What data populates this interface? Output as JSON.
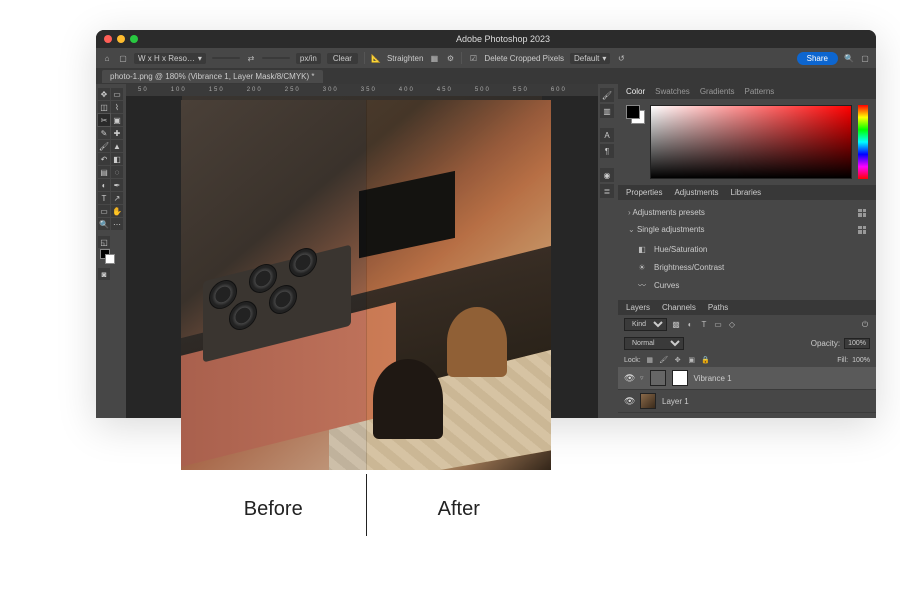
{
  "titlebar": {
    "title": "Adobe Photoshop 2023"
  },
  "optionsbar": {
    "preset": "W x H x Reso…",
    "unit": "px/in",
    "clear": "Clear",
    "straighten": "Straighten",
    "delete_cropped": "Delete Cropped Pixels",
    "content_aware": "Default",
    "share": "Share"
  },
  "doctab": {
    "label": "photo-1.png @ 180% (Vibrance 1, Layer Mask/8/CMYK) *"
  },
  "ruler_ticks": [
    "50",
    "100",
    "150",
    "200",
    "250",
    "300",
    "350",
    "400",
    "450",
    "500",
    "550",
    "600"
  ],
  "color_panel": {
    "tabs": [
      "Color",
      "Swatches",
      "Gradients",
      "Patterns"
    ],
    "active": 0
  },
  "props_panel": {
    "tabs": [
      "Properties",
      "Adjustments",
      "Libraries"
    ],
    "active": 1
  },
  "adjustments": {
    "presets_label": "Adjustments presets",
    "single_label": "Single adjustments",
    "items": [
      {
        "icon": "hue-icon",
        "label": "Hue/Saturation"
      },
      {
        "icon": "brightness-icon",
        "label": "Brightness/Contrast"
      },
      {
        "icon": "curves-icon",
        "label": "Curves"
      }
    ]
  },
  "layers_panel": {
    "tabs": [
      "Layers",
      "Channels",
      "Paths"
    ],
    "active": 0,
    "kind": "Kind",
    "blend": "Normal",
    "opacity_label": "Opacity:",
    "opacity": "100%",
    "lock_label": "Lock:",
    "fill_label": "Fill:",
    "fill": "100%",
    "layers": [
      {
        "name": "Vibrance 1",
        "selected": true,
        "mask": true
      },
      {
        "name": "Layer 1",
        "selected": false,
        "mask": false
      }
    ]
  },
  "comparison": {
    "before": "Before",
    "after": "After"
  }
}
